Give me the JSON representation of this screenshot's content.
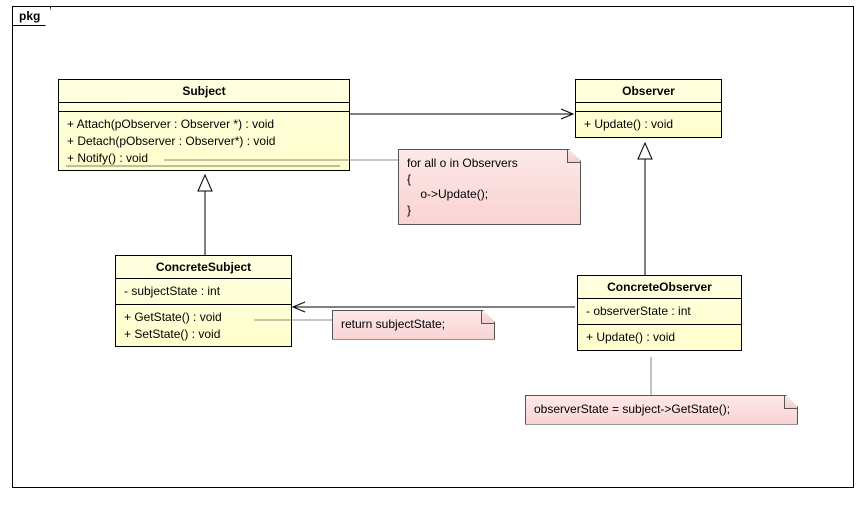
{
  "package": {
    "label": "pkg"
  },
  "classes": {
    "subject": {
      "name": "Subject",
      "ops": [
        "+ Attach(pObserver : Observer *) : void",
        "+ Detach(pObserver : Observer*) : void",
        "+ Notify() : void"
      ]
    },
    "observer": {
      "name": "Observer",
      "ops": [
        "+ Update() : void"
      ]
    },
    "concreteSubject": {
      "name": "ConcreteSubject",
      "attrs": [
        "- subjectState : int"
      ],
      "ops": [
        "+ GetState() : void",
        "+ SetState() : void"
      ]
    },
    "concreteObserver": {
      "name": "ConcreteObserver",
      "attrs": [
        "- observerState : int"
      ],
      "ops": [
        "+ Update() : void"
      ]
    }
  },
  "notes": {
    "notify": {
      "line1": "for all o in Observers",
      "line2": "{",
      "line3": "    o->Update();",
      "line4": "}"
    },
    "getState": {
      "text": "return subjectState;"
    },
    "update": {
      "text": "observerState = subject->GetState();"
    }
  },
  "chart_data": {
    "type": "table",
    "diagram_kind": "UML Class Diagram (Observer pattern)",
    "package": "pkg",
    "classes": [
      {
        "name": "Subject",
        "attributes": [],
        "operations": [
          "+ Attach(pObserver : Observer *) : void",
          "+ Detach(pObserver : Observer*) : void",
          "+ Notify() : void"
        ]
      },
      {
        "name": "Observer",
        "attributes": [],
        "operations": [
          "+ Update() : void"
        ]
      },
      {
        "name": "ConcreteSubject",
        "attributes": [
          "- subjectState : int"
        ],
        "operations": [
          "+ GetState() : void",
          "+ SetState() : void"
        ]
      },
      {
        "name": "ConcreteObserver",
        "attributes": [
          "- observerState : int"
        ],
        "operations": [
          "+ Update() : void"
        ]
      }
    ],
    "relationships": [
      {
        "from": "Subject",
        "to": "Observer",
        "type": "association",
        "arrow": "open"
      },
      {
        "from": "ConcreteSubject",
        "to": "Subject",
        "type": "generalization"
      },
      {
        "from": "ConcreteObserver",
        "to": "Observer",
        "type": "generalization"
      },
      {
        "from": "ConcreteObserver",
        "to": "ConcreteSubject",
        "type": "association",
        "arrow": "open"
      }
    ],
    "notes": [
      {
        "attached_to": "Subject.Notify()",
        "text": "for all o in Observers { o->Update(); }"
      },
      {
        "attached_to": "ConcreteSubject.GetState()",
        "text": "return subjectState;"
      },
      {
        "attached_to": "ConcreteObserver.Update()",
        "text": "observerState = subject->GetState();"
      }
    ]
  }
}
